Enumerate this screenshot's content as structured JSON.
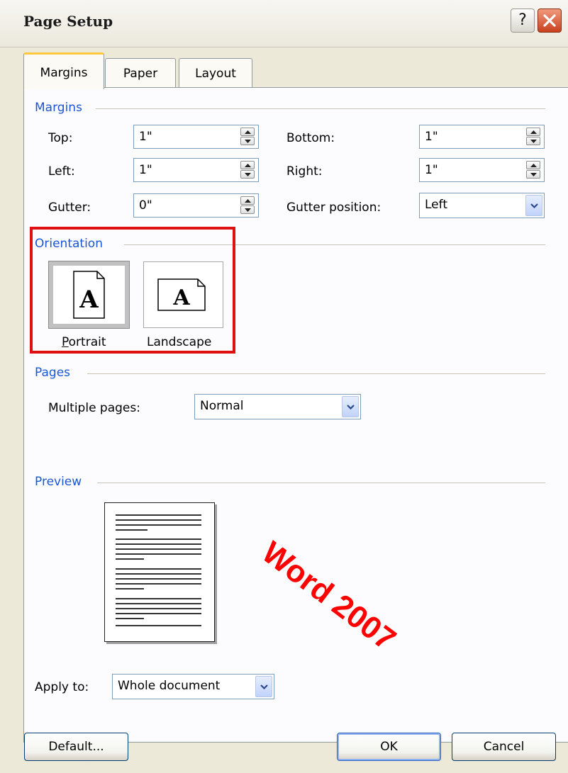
{
  "window": {
    "title": "Page Setup",
    "help_glyph": "?",
    "close_icon": "close-icon"
  },
  "tabs": [
    {
      "label": "Margins",
      "active": true
    },
    {
      "label": "Paper",
      "active": false
    },
    {
      "label": "Layout",
      "active": false
    }
  ],
  "margins": {
    "section": "Margins",
    "top": {
      "label": "Top:",
      "value": "1\""
    },
    "left": {
      "label": "Left:",
      "value": "1\""
    },
    "gutter": {
      "label": "Gutter:",
      "value": "0\""
    },
    "bottom": {
      "label": "Bottom:",
      "value": "1\""
    },
    "right": {
      "label": "Right:",
      "value": "1\""
    },
    "gutter_position": {
      "label": "Gutter position:",
      "value": "Left"
    }
  },
  "orientation": {
    "section": "Orientation",
    "portrait": "Portrait",
    "landscape": "Landscape",
    "selected": "Portrait",
    "glyph": "A"
  },
  "pages": {
    "section": "Pages",
    "multiple_pages_label": "Multiple pages:",
    "multiple_pages_value": "Normal"
  },
  "preview": {
    "section": "Preview"
  },
  "annotation": "Word 2007",
  "apply_to": {
    "label": "Apply to:",
    "value": "Whole document"
  },
  "buttons": {
    "default": "Default...",
    "ok": "OK",
    "cancel": "Cancel"
  },
  "colors": {
    "section_header": "#1b56d3",
    "highlight": "#e01010",
    "annotation": "#ff0000",
    "dialog_bg": "#ECE9D8"
  }
}
